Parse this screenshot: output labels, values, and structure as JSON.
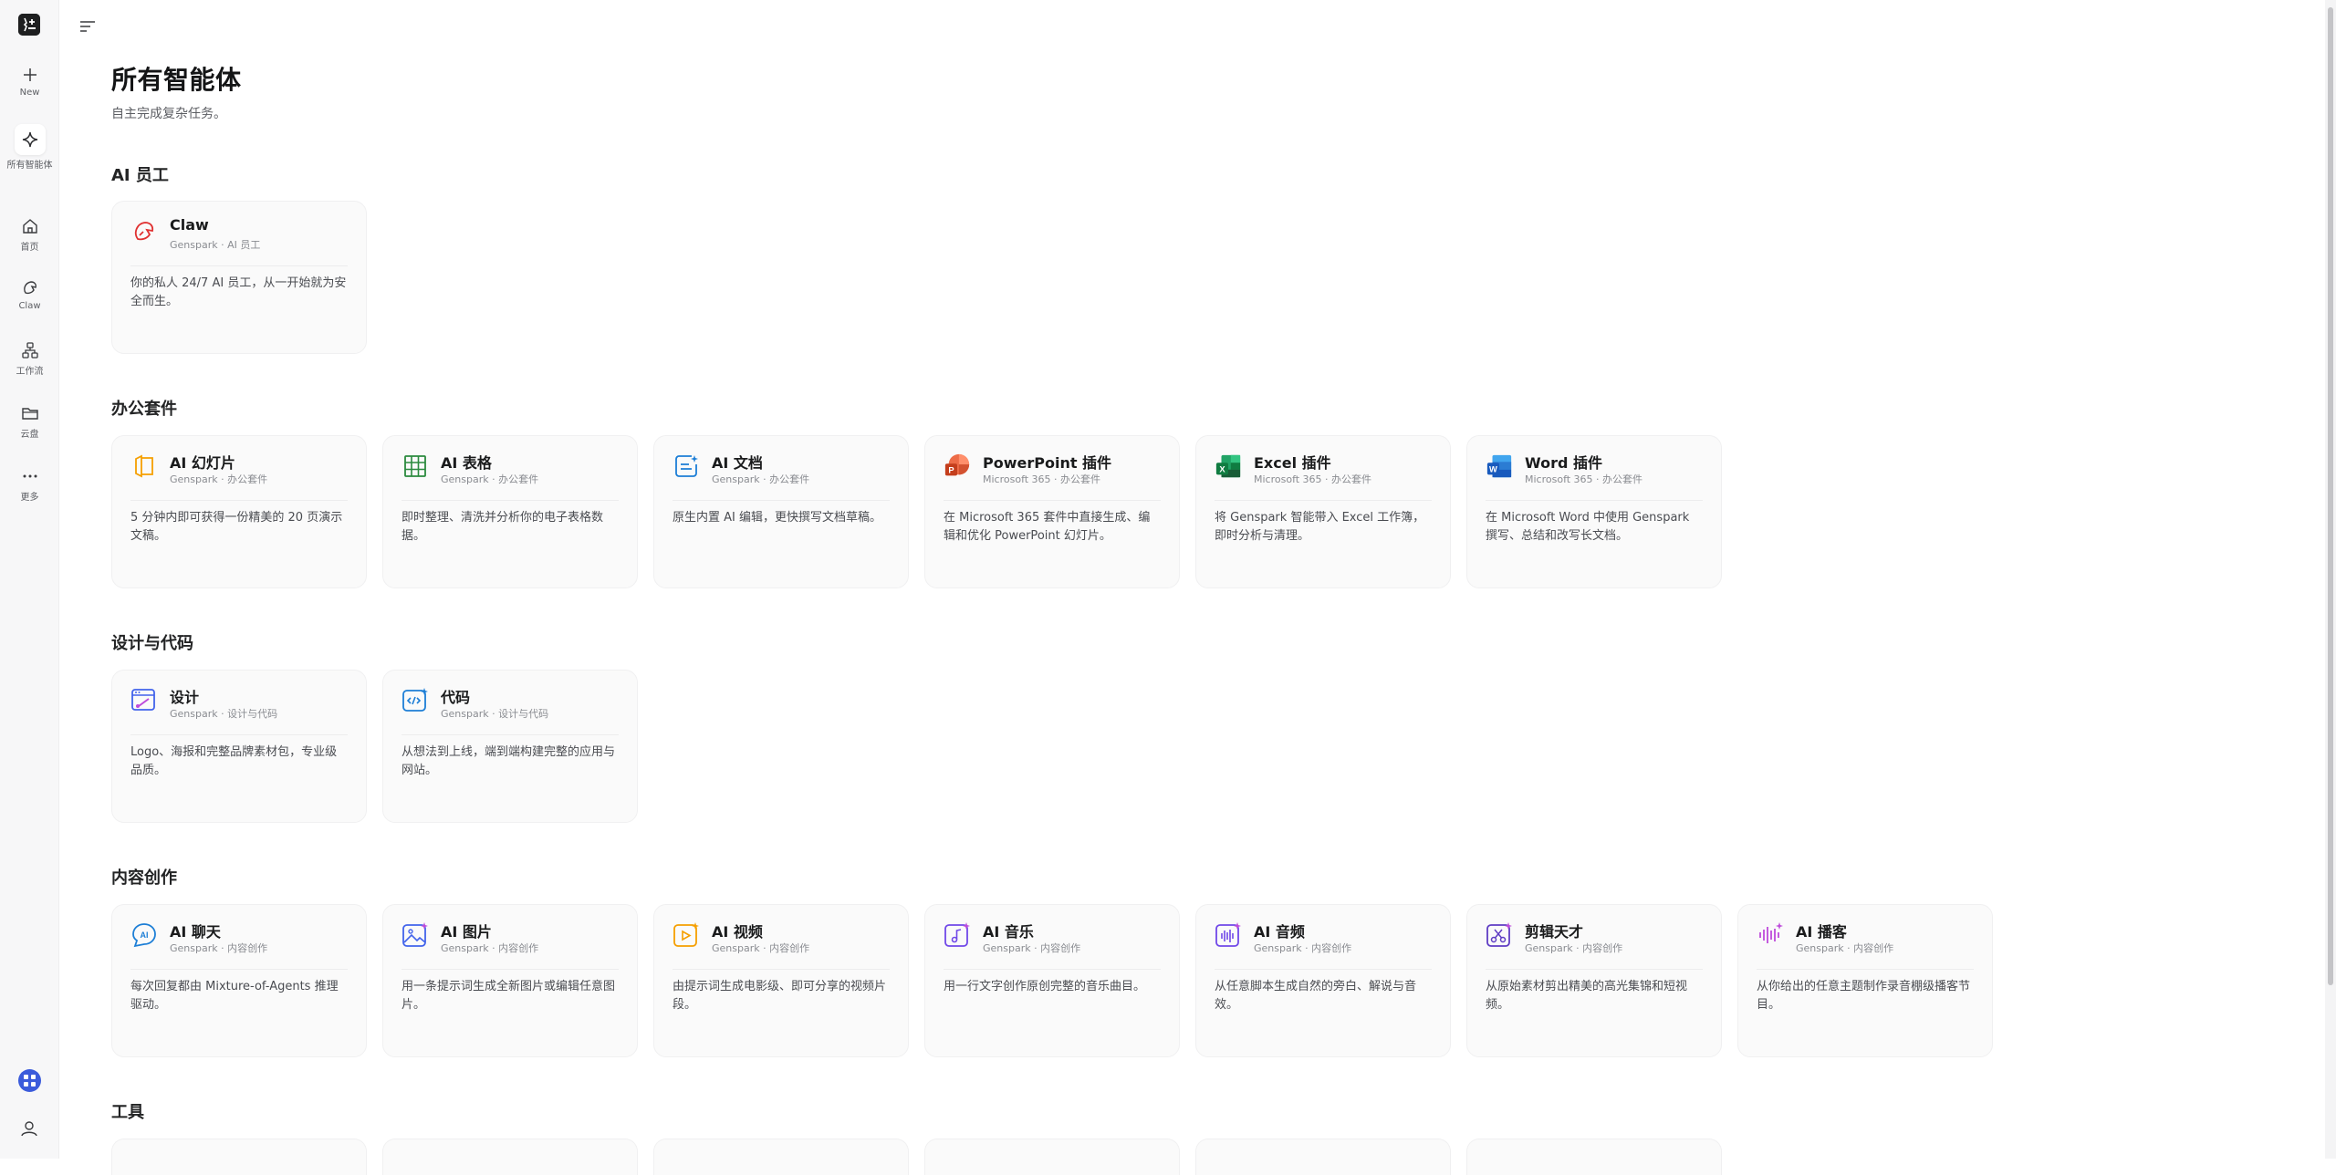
{
  "sidebar": {
    "new_label": "New",
    "agents_label": "所有智能体",
    "home_label": "首页",
    "claw_label": "Claw",
    "workflow_label": "工作流",
    "drive_label": "云盘",
    "more_label": "更多"
  },
  "page": {
    "title": "所有智能体",
    "subtitle": "自主完成复杂任务。"
  },
  "sections": {
    "ai_staff": {
      "title": "AI 员工",
      "cards": [
        {
          "title": "Claw",
          "sub": "Genspark · AI 员工",
          "desc": "你的私人 24/7 AI 员工，从一开始就为安全而生。",
          "icon": "claw-icon"
        }
      ]
    },
    "office": {
      "title": "办公套件",
      "cards": [
        {
          "title": "AI 幻灯片",
          "sub": "Genspark · 办公套件",
          "desc": "5 分钟内即可获得一份精美的 20 页演示文稿。",
          "icon": "slides-icon"
        },
        {
          "title": "AI 表格",
          "sub": "Genspark · 办公套件",
          "desc": "即时整理、清洗并分析你的电子表格数据。",
          "icon": "sheets-icon"
        },
        {
          "title": "AI 文档",
          "sub": "Genspark · 办公套件",
          "desc": "原生内置 AI 编辑，更快撰写文档草稿。",
          "icon": "docs-icon"
        },
        {
          "title": "PowerPoint 插件",
          "sub": "Microsoft 365 · 办公套件",
          "desc": "在 Microsoft 365 套件中直接生成、编辑和优化 PowerPoint 幻灯片。",
          "icon": "powerpoint-icon"
        },
        {
          "title": "Excel 插件",
          "sub": "Microsoft 365 · 办公套件",
          "desc": "将 Genspark 智能带入 Excel 工作簿，即时分析与清理。",
          "icon": "excel-icon"
        },
        {
          "title": "Word 插件",
          "sub": "Microsoft 365 · 办公套件",
          "desc": "在 Microsoft Word 中使用 Genspark 撰写、总结和改写长文档。",
          "icon": "word-icon"
        }
      ]
    },
    "design": {
      "title": "设计与代码",
      "cards": [
        {
          "title": "设计",
          "sub": "Genspark · 设计与代码",
          "desc": "Logo、海报和完整品牌素材包，专业级品质。",
          "icon": "design-icon"
        },
        {
          "title": "代码",
          "sub": "Genspark · 设计与代码",
          "desc": "从想法到上线，端到端构建完整的应用与网站。",
          "icon": "code-icon"
        }
      ]
    },
    "content": {
      "title": "内容创作",
      "cards": [
        {
          "title": "AI 聊天",
          "sub": "Genspark · 内容创作",
          "desc": "每次回复都由 Mixture-of-Agents 推理驱动。",
          "icon": "chat-icon"
        },
        {
          "title": "AI 图片",
          "sub": "Genspark · 内容创作",
          "desc": "用一条提示词生成全新图片或编辑任意图片。",
          "icon": "image-icon"
        },
        {
          "title": "AI 视频",
          "sub": "Genspark · 内容创作",
          "desc": "由提示词生成电影级、即可分享的视频片段。",
          "icon": "video-icon"
        },
        {
          "title": "AI 音乐",
          "sub": "Genspark · 内容创作",
          "desc": "用一行文字创作原创完整的音乐曲目。",
          "icon": "music-icon"
        },
        {
          "title": "AI 音频",
          "sub": "Genspark · 内容创作",
          "desc": "从任意脚本生成自然的旁白、解说与音效。",
          "icon": "audio-icon"
        },
        {
          "title": "剪辑天才",
          "sub": "Genspark · 内容创作",
          "desc": "从原始素材剪出精美的高光集锦和短视频。",
          "icon": "clip-icon"
        },
        {
          "title": "AI 播客",
          "sub": "Genspark · 内容创作",
          "desc": "从你给出的任意主题制作录音棚级播客节目。",
          "icon": "podcast-icon"
        }
      ]
    },
    "tools": {
      "title": "工具"
    }
  },
  "colors": {
    "accent_blue": "#3b5bdb",
    "claw_red": "#e03131",
    "slides_orange": "#f59f00",
    "sheets_green": "#2b8a3e",
    "docs_blue": "#1c7ed6",
    "purple": "#7048e8"
  }
}
